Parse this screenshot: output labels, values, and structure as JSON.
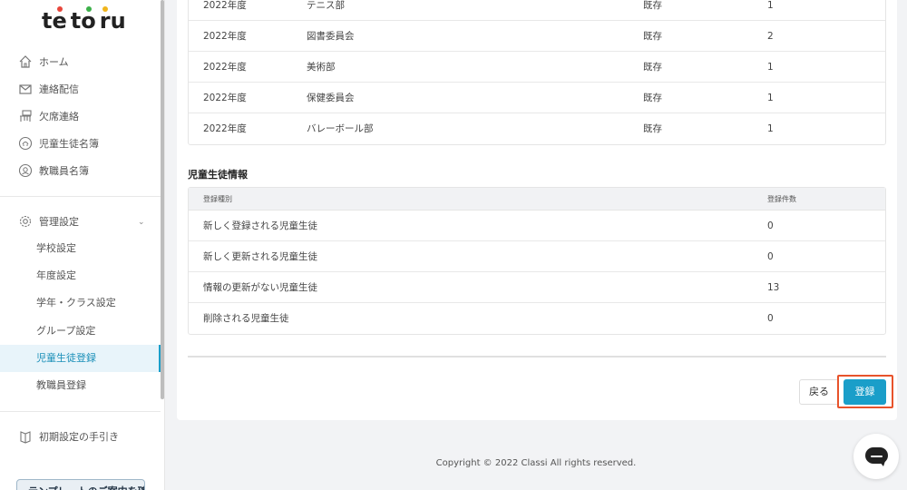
{
  "sidebar": {
    "logo": [
      "t",
      "e",
      "t",
      "o",
      "r",
      "u"
    ],
    "nav": [
      {
        "label": "ホーム",
        "icon": "home-icon"
      },
      {
        "label": "連絡配信",
        "icon": "mail-icon"
      },
      {
        "label": "欠席連絡",
        "icon": "desk-icon"
      },
      {
        "label": "児童生徒名簿",
        "icon": "student-roster-icon"
      },
      {
        "label": "教職員名簿",
        "icon": "staff-roster-icon"
      }
    ],
    "admin_label": "管理設定",
    "sub_items": [
      "学校設定",
      "年度設定",
      "学年・クラス設定",
      "グループ設定",
      "児童生徒登録",
      "教職員登録"
    ],
    "guide_label": "初期設定の手引き",
    "bottom_button": "テンプレートのご案内を確認"
  },
  "group_rows": [
    {
      "year": "2022年度",
      "name": "テニス部",
      "status": "既存",
      "count": "1"
    },
    {
      "year": "2022年度",
      "name": "図書委員会",
      "status": "既存",
      "count": "2"
    },
    {
      "year": "2022年度",
      "name": "美術部",
      "status": "既存",
      "count": "1"
    },
    {
      "year": "2022年度",
      "name": "保健委員会",
      "status": "既存",
      "count": "1"
    },
    {
      "year": "2022年度",
      "name": "バレーボール部",
      "status": "既存",
      "count": "1"
    }
  ],
  "student_section": {
    "title": "児童生徒情報",
    "header": {
      "type": "登録種別",
      "count": "登録件数"
    },
    "rows": [
      {
        "type": "新しく登録される児童生徒",
        "count": "0"
      },
      {
        "type": "新しく更新される児童生徒",
        "count": "0"
      },
      {
        "type": "情報の更新がない児童生徒",
        "count": "13"
      },
      {
        "type": "削除される児童生徒",
        "count": "0"
      }
    ]
  },
  "buttons": {
    "back": "戻る",
    "register": "登録"
  },
  "footer": "Copyright © 2022 Classi All rights reserved.",
  "colors": {
    "accent": "#1a9ec9",
    "highlight": "#e8532b"
  }
}
